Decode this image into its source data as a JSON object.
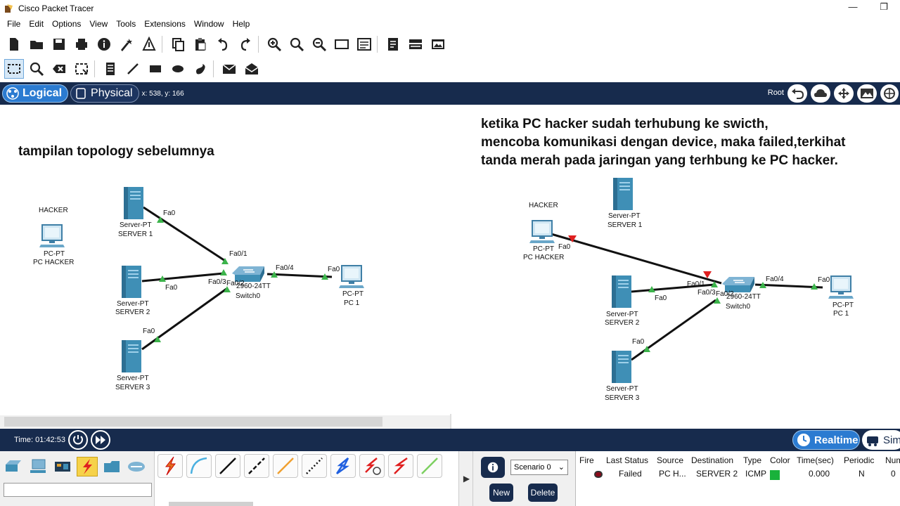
{
  "app": {
    "title": "Cisco Packet Tracer"
  },
  "window_controls": {
    "minimize": "—",
    "restore": "❐"
  },
  "menu": [
    "File",
    "Edit",
    "Options",
    "View",
    "Tools",
    "Extensions",
    "Window",
    "Help"
  ],
  "toolbar1": [
    "new-file-icon",
    "open-folder-icon",
    "save-icon",
    "print-icon",
    "info-icon",
    "activity-wizard-icon",
    "network-information-icon",
    "copy-icon",
    "paste-icon",
    "undo-icon",
    "redo-icon",
    "zoom-in-icon",
    "zoom-reset-icon",
    "zoom-out-icon",
    "drawing-palette-icon",
    "custom-device-dialog-icon",
    "pdu-list-icon",
    "viewport-icon",
    "image-icon"
  ],
  "toolbar2": [
    "select-icon",
    "inspect-icon",
    "delete-icon",
    "resize-shape-icon",
    "place-note-icon",
    "draw-line-icon",
    "draw-rectangle-icon",
    "draw-ellipse-icon",
    "freeform-icon",
    "add-simple-pdu-icon",
    "add-complex-pdu-icon"
  ],
  "workspace": {
    "tab_logical": "Logical",
    "tab_physical": "Physical",
    "coords": "x: 538, y: 166",
    "root_label": "Root"
  },
  "notes": {
    "left": "tampilan topology sebelumnya",
    "right": "ketika PC hacker sudah terhubung ke swicth,\nmencoba komunikasi dengan device, maka failed,terkihat\ntanda merah pada jaringan yang terhbung ke PC hacker."
  },
  "topology_left": {
    "hacker_label": "HACKER",
    "pc_hacker": {
      "type": "PC-PT",
      "name": "PC HACKER"
    },
    "server1": {
      "type": "Server-PT",
      "name": "SERVER 1",
      "port": "Fa0"
    },
    "server2": {
      "type": "Server-PT",
      "name": "SERVER 2",
      "port": "Fa0"
    },
    "server3": {
      "type": "Server-PT",
      "name": "SERVER 3",
      "port": "Fa0"
    },
    "pc1": {
      "type": "PC-PT",
      "name": "PC 1",
      "port": "Fa0"
    },
    "switch": {
      "model": "2960-24TT",
      "name": "Switch0",
      "p1": "Fa0/1",
      "p2": "Fa0/2",
      "p3": "Fa0/3",
      "p4": "Fa0/4"
    }
  },
  "topology_right": {
    "hacker_label": "HACKER",
    "pc_hacker": {
      "type": "PC-PT",
      "name": "PC HACKER",
      "port": "Fa0"
    },
    "server1": {
      "type": "Server-PT",
      "name": "SERVER 1"
    },
    "server2": {
      "type": "Server-PT",
      "name": "SERVER 2",
      "port": "Fa0"
    },
    "server3": {
      "type": "Server-PT",
      "name": "SERVER 3",
      "port": "Fa0"
    },
    "pc1": {
      "type": "PC-PT",
      "name": "PC 1",
      "port": "Fa0"
    },
    "switch": {
      "model": "2960-24TT",
      "name": "Switch0",
      "p1": "Fa0/1",
      "p2": "Fa0/2",
      "p3": "Fa0/3",
      "p4": "Fa0/4"
    }
  },
  "timebar": {
    "time": "Time: 01:42:53",
    "realtime": "Realtime",
    "simulation": "Sim"
  },
  "device_categories": [
    "network-devices-icon",
    "end-devices-icon",
    "components-icon",
    "connections-icon",
    "misc-icon",
    "multiuser-icon"
  ],
  "cables": [
    "automatic-cable-icon",
    "console-cable-icon",
    "copper-straight-icon",
    "copper-cross-icon",
    "fiber-icon",
    "phone-cable-icon",
    "coaxial-icon",
    "serial-dce-icon",
    "serial-dte-icon",
    "octal-cable-icon"
  ],
  "scenario": {
    "selected": "Scenario 0",
    "new": "New",
    "delete": "Delete"
  },
  "pdu_table": {
    "headers": [
      "Fire",
      "Last Status",
      "Source",
      "Destination",
      "Type",
      "Color",
      "Time(sec)",
      "Periodic",
      "Num"
    ],
    "rows": [
      {
        "status": "Failed",
        "source": "PC H...",
        "destination": "SERVER 2",
        "type": "ICMP",
        "color": "#19b23b",
        "time": "0.000",
        "periodic": "N",
        "num": "0"
      }
    ]
  },
  "colors": {
    "navy": "#172b4d",
    "accent": "#2b7bd1",
    "link_ok": "#3cb44b",
    "link_fail": "#e02020"
  }
}
